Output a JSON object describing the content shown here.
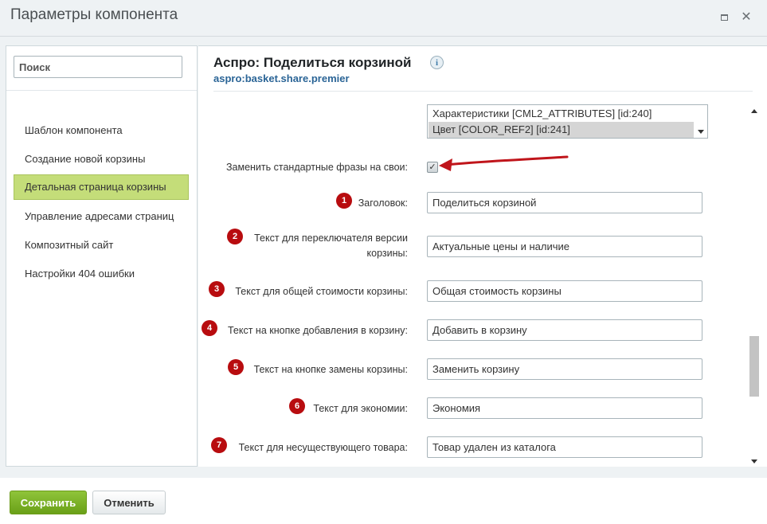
{
  "window": {
    "title": "Параметры компонента"
  },
  "sidebar": {
    "search_placeholder": "Поиск",
    "items": [
      {
        "label": "Шаблон компонента"
      },
      {
        "label": "Создание новой корзины"
      },
      {
        "label": "Детальная страница корзины",
        "active": true
      },
      {
        "label": "Управление адресами страниц"
      },
      {
        "label": "Композитный сайт"
      },
      {
        "label": "Настройки 404 ошибки"
      }
    ]
  },
  "component": {
    "title": "Аспро: Поделиться корзиной",
    "code": "aspro:basket.share.premier",
    "info_icon": "i"
  },
  "properties_list": {
    "options": [
      {
        "label": "Характеристики [CML2_ATTRIBUTES] [id:240]",
        "selected": false
      },
      {
        "label": "Цвет [COLOR_REF2] [id:241]",
        "selected": true
      }
    ]
  },
  "replace_phrases": {
    "label": "Заменить стандартные фразы на свои:",
    "checked": true,
    "check_glyph": "✓"
  },
  "fields": [
    {
      "badge": "1",
      "label": "Заголовок:",
      "value": "Поделиться корзиной"
    },
    {
      "badge": "2",
      "label_line1": "Текст для переключателя версии",
      "label_line2": "корзины:",
      "value": "Актуальные цены и наличие"
    },
    {
      "badge": "3",
      "label": "Текст для общей стоимости корзины:",
      "value": "Общая стоимость корзины"
    },
    {
      "badge": "4",
      "label": "Текст на кнопке добавления в корзину:",
      "value": "Добавить в корзину"
    },
    {
      "badge": "5",
      "label": "Текст на кнопке замены корзины:",
      "value": "Заменить корзину"
    },
    {
      "badge": "6",
      "label": "Текст для экономии:",
      "value": "Экономия"
    },
    {
      "badge": "7",
      "label": "Текст для несуществующего товара:",
      "value": "Товар удален из каталога"
    }
  ],
  "footer": {
    "save_label": "Сохранить",
    "cancel_label": "Отменить"
  },
  "colors": {
    "badge": "#b80c0f",
    "arrow": "#c0151b",
    "active_nav": "#c4dd79",
    "save_button": "#7ab228",
    "link": "#2a6496"
  },
  "icons": {
    "maximize": "maximize-icon",
    "close": "close-icon",
    "info": "info-icon",
    "annotation_arrow": "arrow-icon"
  }
}
